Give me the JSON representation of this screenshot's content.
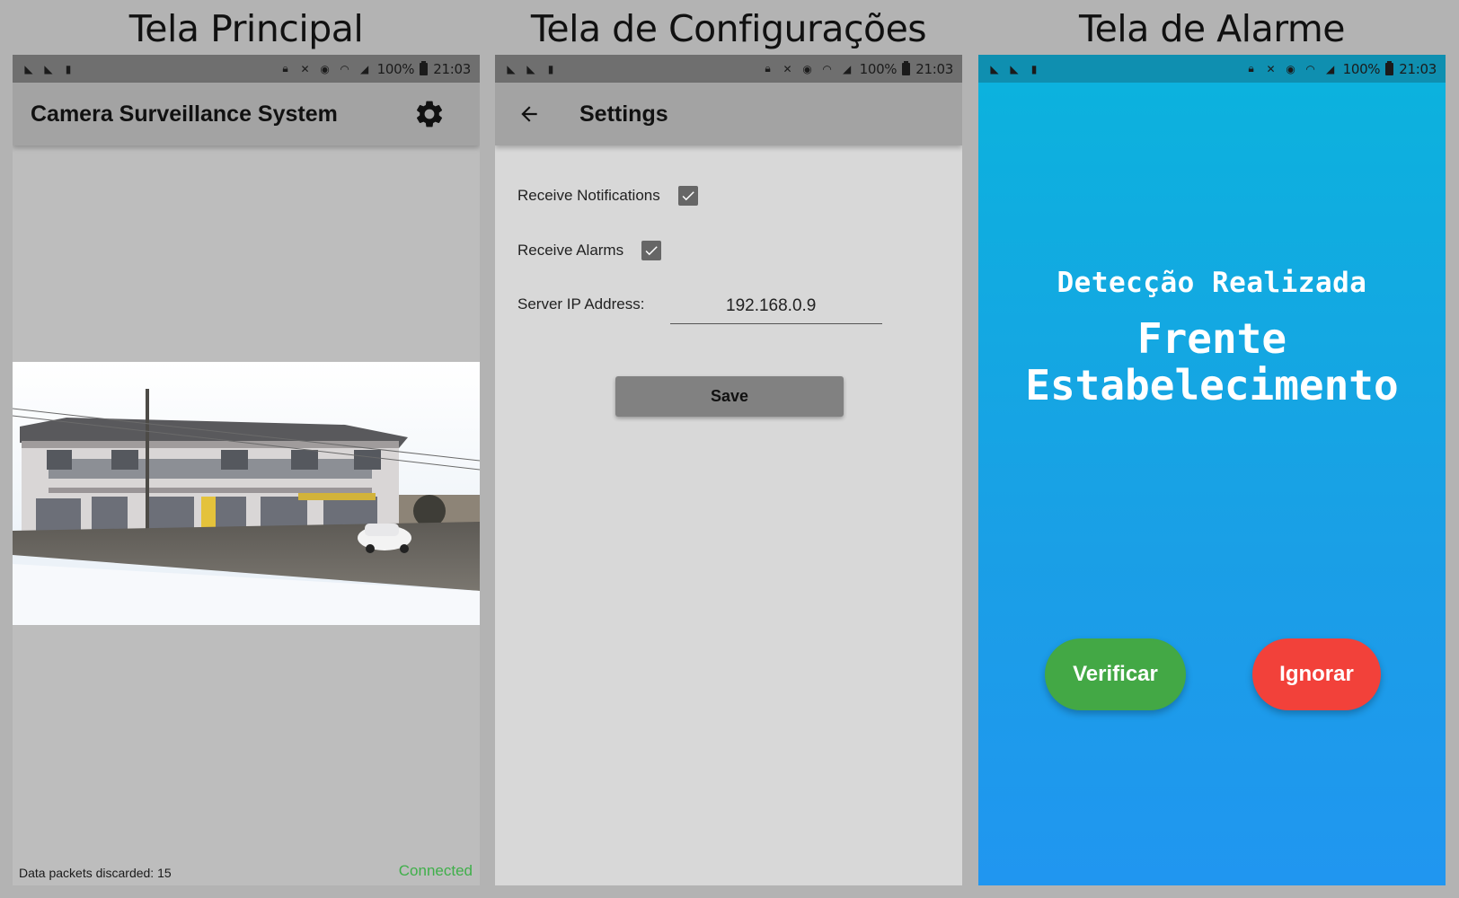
{
  "captions": {
    "main": "Tela Principal",
    "config": "Tela de Configurações",
    "alarm": "Tela de Alarme"
  },
  "statusbar": {
    "battery": "100%",
    "time": "21:03"
  },
  "main_screen": {
    "title": "Camera Surveillance System",
    "settings_icon": "gear-icon",
    "discarded_label": "Data packets discarded: 15",
    "connection_status": "Connected",
    "connection_color": "#3faf4a"
  },
  "settings_screen": {
    "title": "Settings",
    "notifications_label": "Receive Notifications",
    "notifications_checked": true,
    "alarms_label": "Receive Alarms",
    "alarms_checked": true,
    "ip_label": "Server IP Address:",
    "ip_value": "192.168.0.9",
    "save_label": "Save"
  },
  "alarm_screen": {
    "subtitle": "Detecção Realizada",
    "location_line1": "Frente",
    "location_line2": "Estabelecimento",
    "verify_label": "Verificar",
    "verify_color": "#43a845",
    "ignore_label": "Ignorar",
    "ignore_color": "#f2413a"
  }
}
